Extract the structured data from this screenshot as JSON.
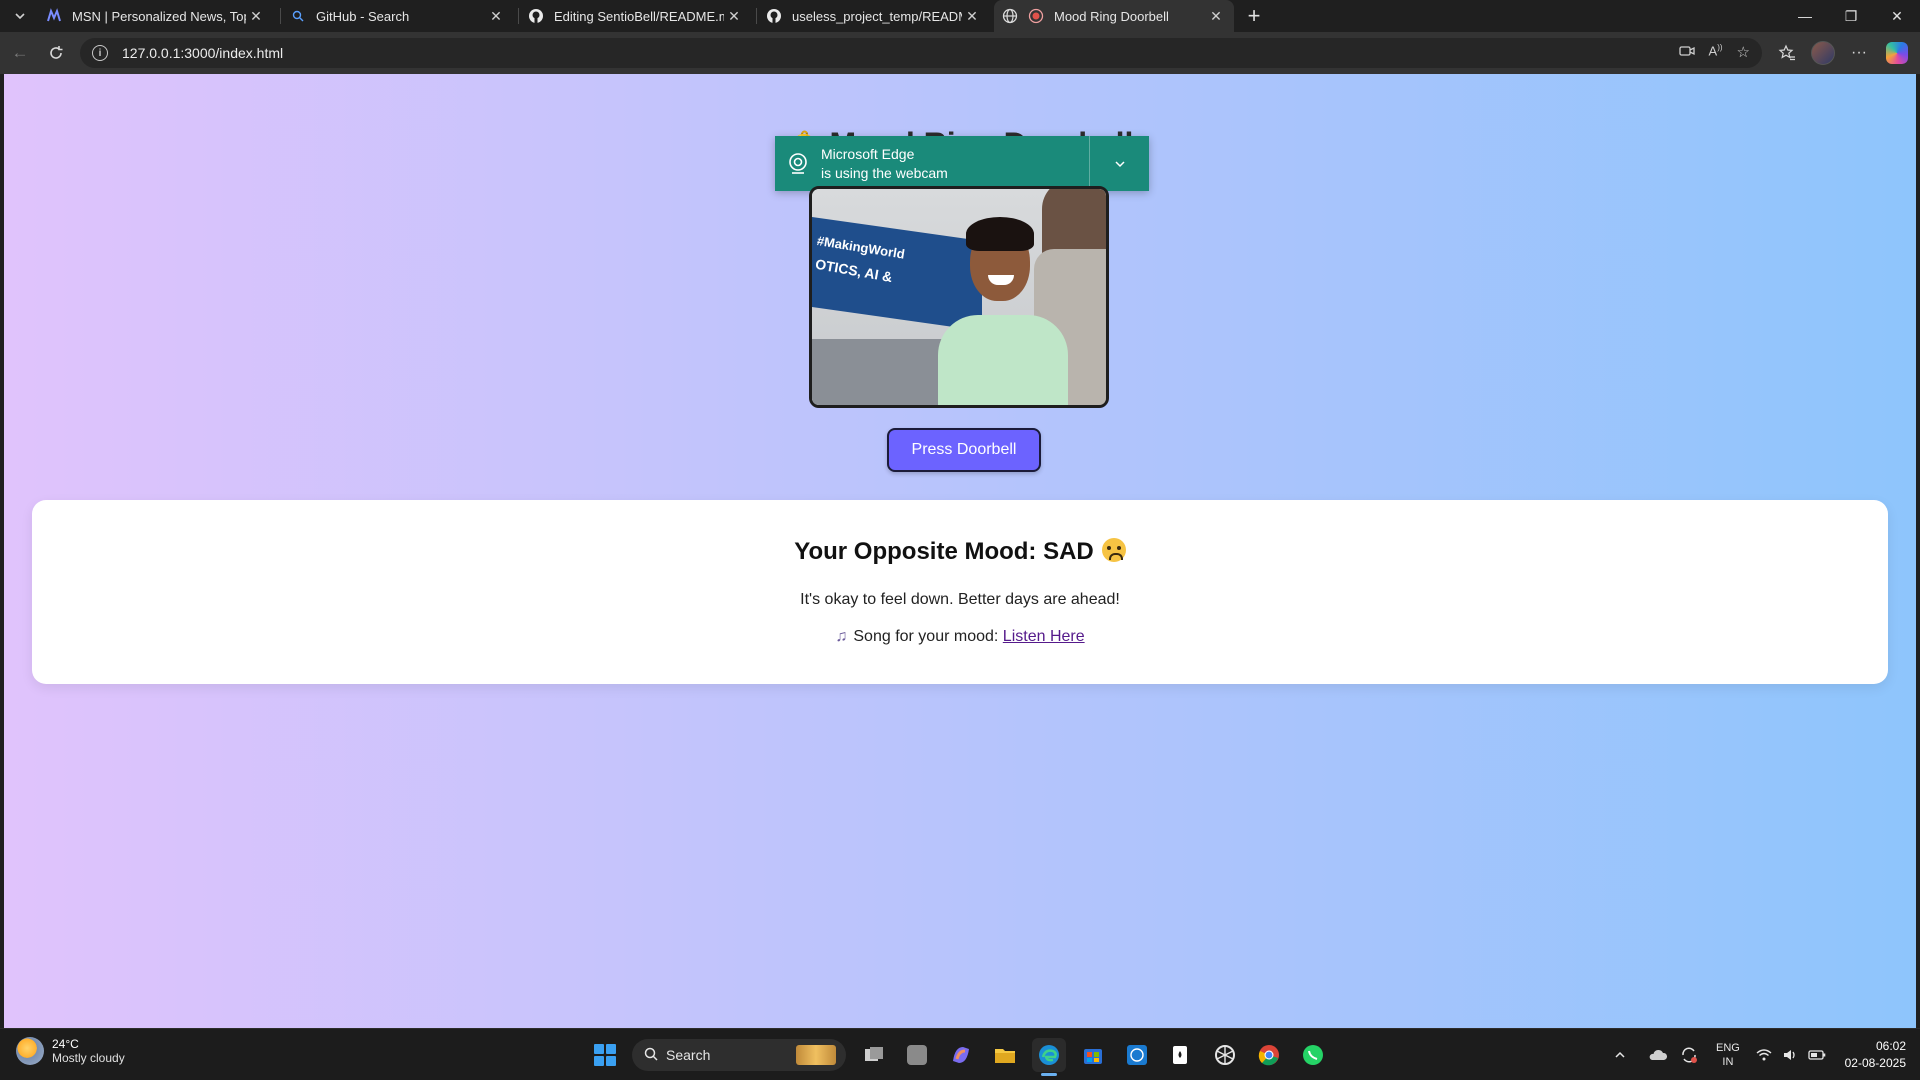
{
  "browser": {
    "tabs": [
      {
        "title": "MSN | Personalized News, Top He",
        "icon": "msn-icon"
      },
      {
        "title": "GitHub - Search",
        "icon": "search-icon"
      },
      {
        "title": "Editing SentioBell/README.md at",
        "icon": "github-icon"
      },
      {
        "title": "useless_project_temp/README.m",
        "icon": "github-icon"
      },
      {
        "title": "Mood Ring Doorbell",
        "icon": "recording-icon",
        "active": true
      }
    ],
    "address": "127.0.0.1:3000/index.html"
  },
  "page": {
    "title": "Mood Ring Doorbell",
    "webcam_notice": {
      "line1": "Microsoft Edge",
      "line2": "is using the webcam"
    },
    "doorbell_button": "Press Doorbell",
    "mood": {
      "heading": "Your Opposite Mood: SAD",
      "message": "It's okay to feel down. Better days are ahead!",
      "song_prefix": "Song for your mood:",
      "song_link": "Listen Here"
    },
    "colors": {
      "gradient_start": "#e0c3fc",
      "gradient_end": "#8ec5fc",
      "button": "#6c63ff",
      "toast": "#1a8a7a"
    }
  },
  "taskbar": {
    "weather": {
      "temp": "24°C",
      "condition": "Mostly cloudy"
    },
    "search_placeholder": "Search",
    "language": {
      "line1": "ENG",
      "line2": "IN"
    },
    "clock": {
      "time": "06:02",
      "date": "02-08-2025"
    }
  }
}
